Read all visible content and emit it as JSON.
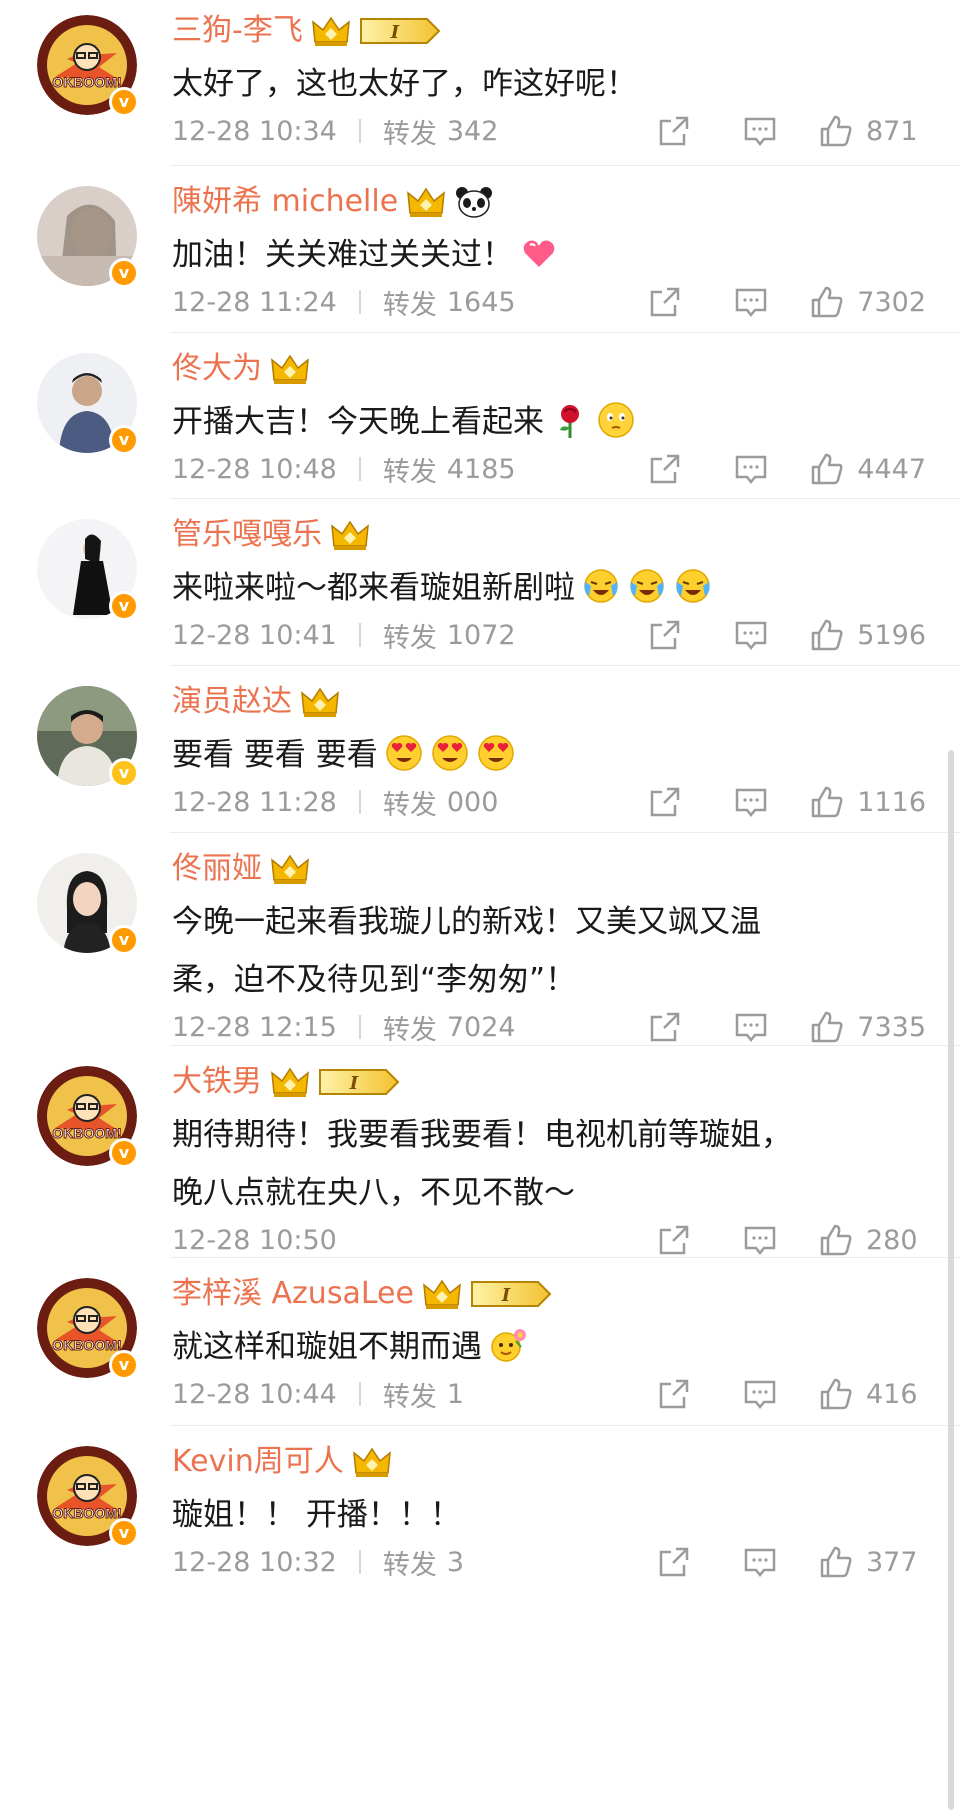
{
  "comments": [
    {
      "name": "三狗-李飞",
      "badge": "crown-level",
      "level": "I",
      "content": "太好了，这也太好了，咋这好呢！",
      "emojis": [],
      "time": "12-28 10:34",
      "repost_label": "转发",
      "repost_count": "342",
      "likes": "871",
      "avatar": "okboom-cartoon",
      "verified": "orange"
    },
    {
      "name": "陳妍希 michelle",
      "badge": "crown-panda",
      "level": "",
      "content": "加油！关关难过关关过！",
      "emojis": [
        "heart-emoji"
      ],
      "time": "12-28 11:24",
      "repost_label": "转发",
      "repost_count": "1645",
      "likes": "7302",
      "avatar": "photo-woman",
      "verified": "orange"
    },
    {
      "name": "佟大为",
      "badge": "crown",
      "level": "",
      "content": "开播大吉！今天晚上看起来",
      "emojis": [
        "rose-emoji",
        "thinking-emoji"
      ],
      "time": "12-28 10:48",
      "repost_label": "转发",
      "repost_count": "4185",
      "likes": "4447",
      "avatar": "photo-man",
      "verified": "orange"
    },
    {
      "name": "管乐嘎嘎乐",
      "badge": "crown",
      "level": "",
      "content": "来啦来啦～都来看璇姐新剧啦",
      "emojis": [
        "laugh-cry-emoji",
        "laugh-cry-emoji",
        "laugh-cry-emoji"
      ],
      "time": "12-28 10:41",
      "repost_label": "转发",
      "repost_count": "1072",
      "likes": "5196",
      "avatar": "photo-dress",
      "verified": "orange"
    },
    {
      "name": "演员赵达",
      "badge": "crown",
      "level": "",
      "content": "要看 要看 要看",
      "emojis": [
        "heart-eyes-emoji",
        "heart-eyes-emoji",
        "heart-eyes-emoji"
      ],
      "time": "12-28 11:28",
      "repost_label": "转发",
      "repost_count": "000",
      "likes": "1116",
      "avatar": "photo-man2",
      "verified": "gold"
    },
    {
      "name": "佟丽娅",
      "badge": "crown",
      "level": "",
      "content": "今晚一起来看我璇儿的新戏！又美又飒又温\n柔，迫不及待见到“李匆匆”！",
      "emojis": [],
      "time": "12-28 12:15",
      "repost_label": "转发",
      "repost_count": "7024",
      "likes": "7335",
      "avatar": "photo-woman2",
      "verified": "orange"
    },
    {
      "name": "大铁男",
      "badge": "crown-level",
      "level": "I",
      "content": "期待期待！我要看我要看！电视机前等璇姐，\n晚八点就在央八，不见不散～",
      "emojis": [],
      "time": "12-28 10:50",
      "repost_label": "",
      "repost_count": "",
      "likes": "280",
      "avatar": "okboom-cartoon",
      "verified": "orange"
    },
    {
      "name": "李梓溪 AzusaLee",
      "badge": "crown-level",
      "level": "I",
      "content": "就这样和璇姐不期而遇",
      "emojis": [
        "flower-emoji"
      ],
      "time": "12-28 10:44",
      "repost_label": "转发",
      "repost_count": "1",
      "likes": "416",
      "avatar": "okboom-cartoon",
      "verified": "orange"
    },
    {
      "name": "Kevin周可人",
      "badge": "crown",
      "level": "",
      "content": "璇姐！！ 开播！！！",
      "emojis": [],
      "time": "12-28 10:32",
      "repost_label": "转发",
      "repost_count": "3",
      "likes": "377",
      "avatar": "okboom-cartoon",
      "verified": "orange"
    }
  ],
  "colors": {
    "name": "#eb7350",
    "meta": "#9b9b9b",
    "verified": "#ff9a00",
    "crown": "#f5b800"
  },
  "icons": {
    "share": "share-icon",
    "reply": "comment-icon",
    "like": "thumbs-up-icon"
  }
}
